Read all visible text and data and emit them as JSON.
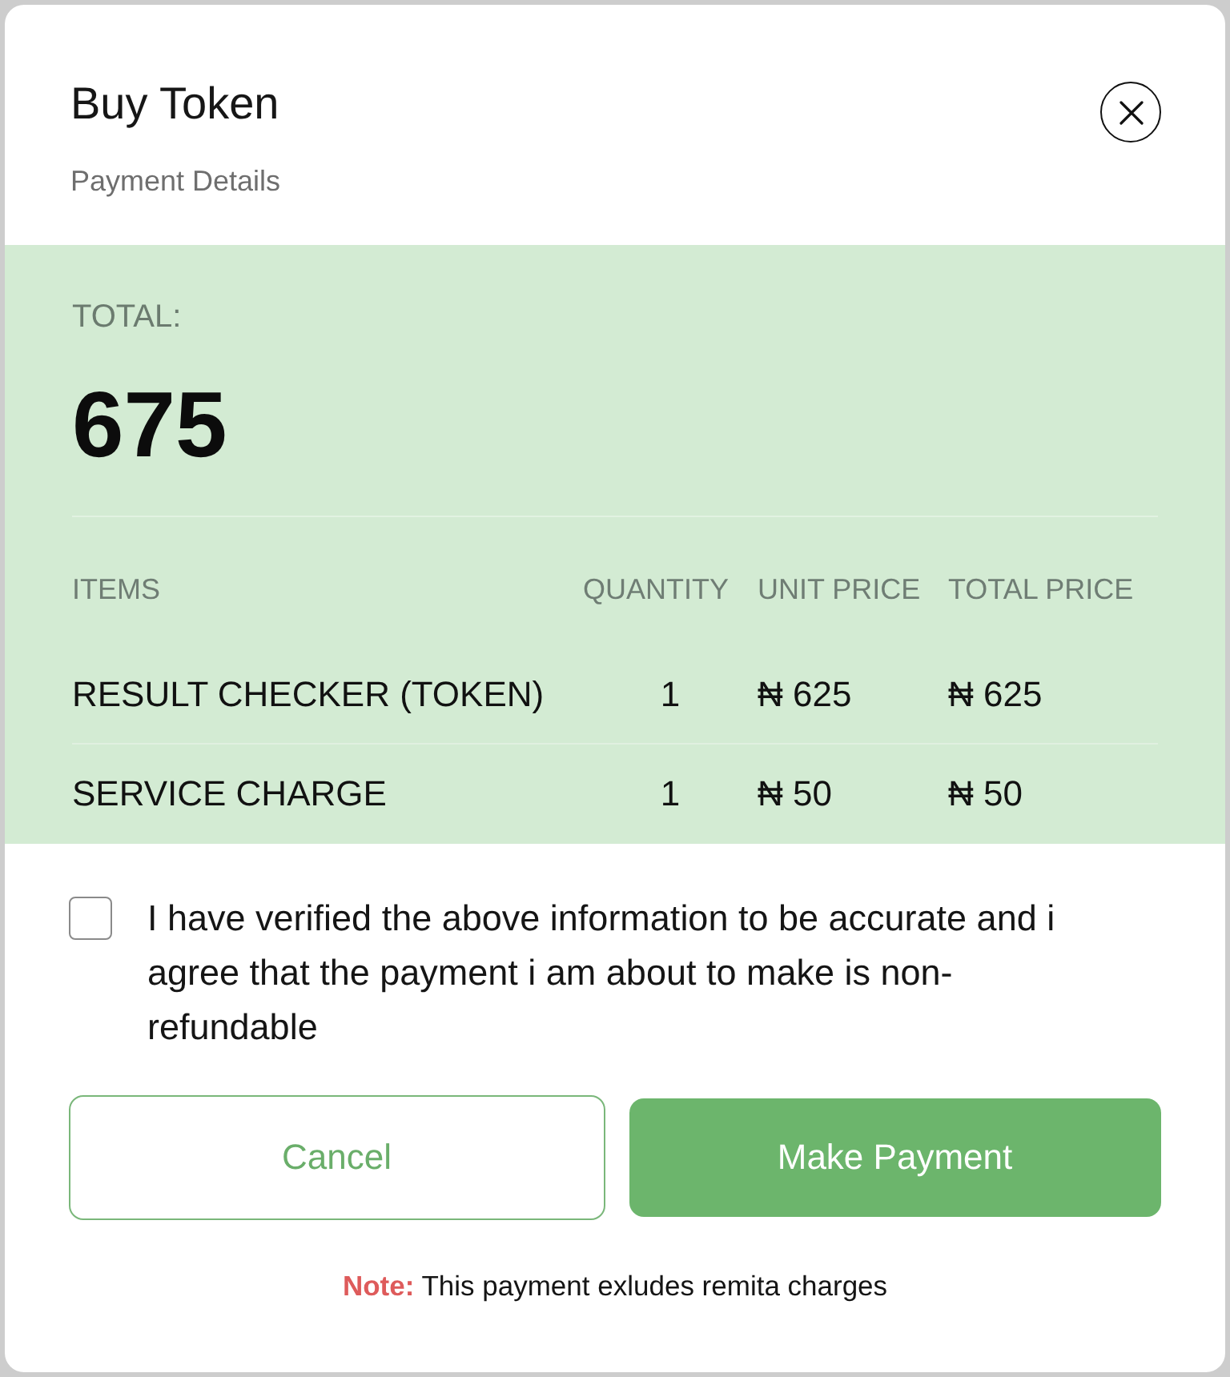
{
  "dialog": {
    "title": "Buy Token",
    "subtitle": "Payment Details"
  },
  "summary": {
    "total_label": "TOTAL:",
    "total": "675"
  },
  "table": {
    "columns": [
      "ITEMS",
      "QUANTITY",
      "UNIT PRICE",
      "TOTAL PRICE"
    ],
    "rows": [
      {
        "item": "RESULT CHECKER (TOKEN)",
        "quantity": "1",
        "unit_price": "₦ 625",
        "total_price": "₦ 625"
      },
      {
        "item": "SERVICE CHARGE",
        "quantity": "1",
        "unit_price": "₦ 50",
        "total_price": "₦ 50"
      }
    ]
  },
  "agreement": {
    "checked": false,
    "text": "I have verified the above information to be accurate and i agree that the payment i am about to make is non-refundable"
  },
  "buttons": [
    {
      "label": "Cancel",
      "kind": "secondary"
    },
    {
      "label": "Make Payment",
      "kind": "primary"
    }
  ],
  "note": "**Note:** This payment exludes remita charges"
}
